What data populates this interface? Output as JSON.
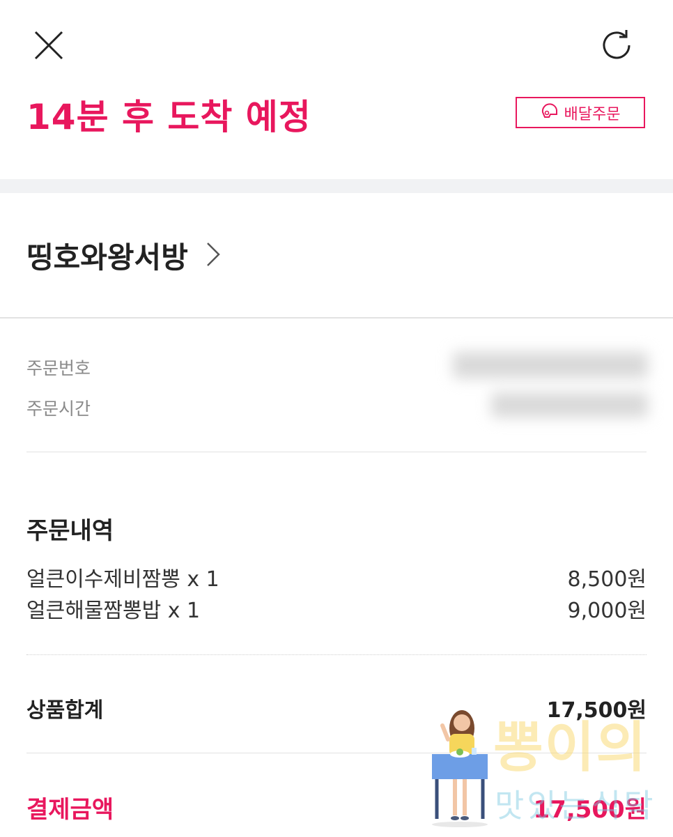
{
  "header": {
    "close_icon": "close-icon",
    "refresh_icon": "refresh-icon"
  },
  "status": {
    "eta_text": "14분 후 도착 예정",
    "order_type": "배달주문",
    "order_type_icon": "helmet-icon",
    "accent_color": "#e8175d"
  },
  "store": {
    "name": "띵호와왕서방",
    "chevron_icon": "chevron-right-icon"
  },
  "order_meta": {
    "order_number_label": "주문번호",
    "order_time_label": "주문시간"
  },
  "order_details": {
    "title": "주문내역",
    "items": [
      {
        "name": "얼큰이수제비짬뽕 x 1",
        "price": "8,500원"
      },
      {
        "name": "얼큰해물짬뽕밥 x 1",
        "price": "9,000원"
      }
    ]
  },
  "summary": {
    "subtotal_label": "상품합계",
    "subtotal_value": "17,500원",
    "payment_label": "결제금액",
    "payment_value": "17,500원"
  },
  "watermark": {
    "line1": "뽕이의",
    "line2": "맛있는식탁"
  }
}
